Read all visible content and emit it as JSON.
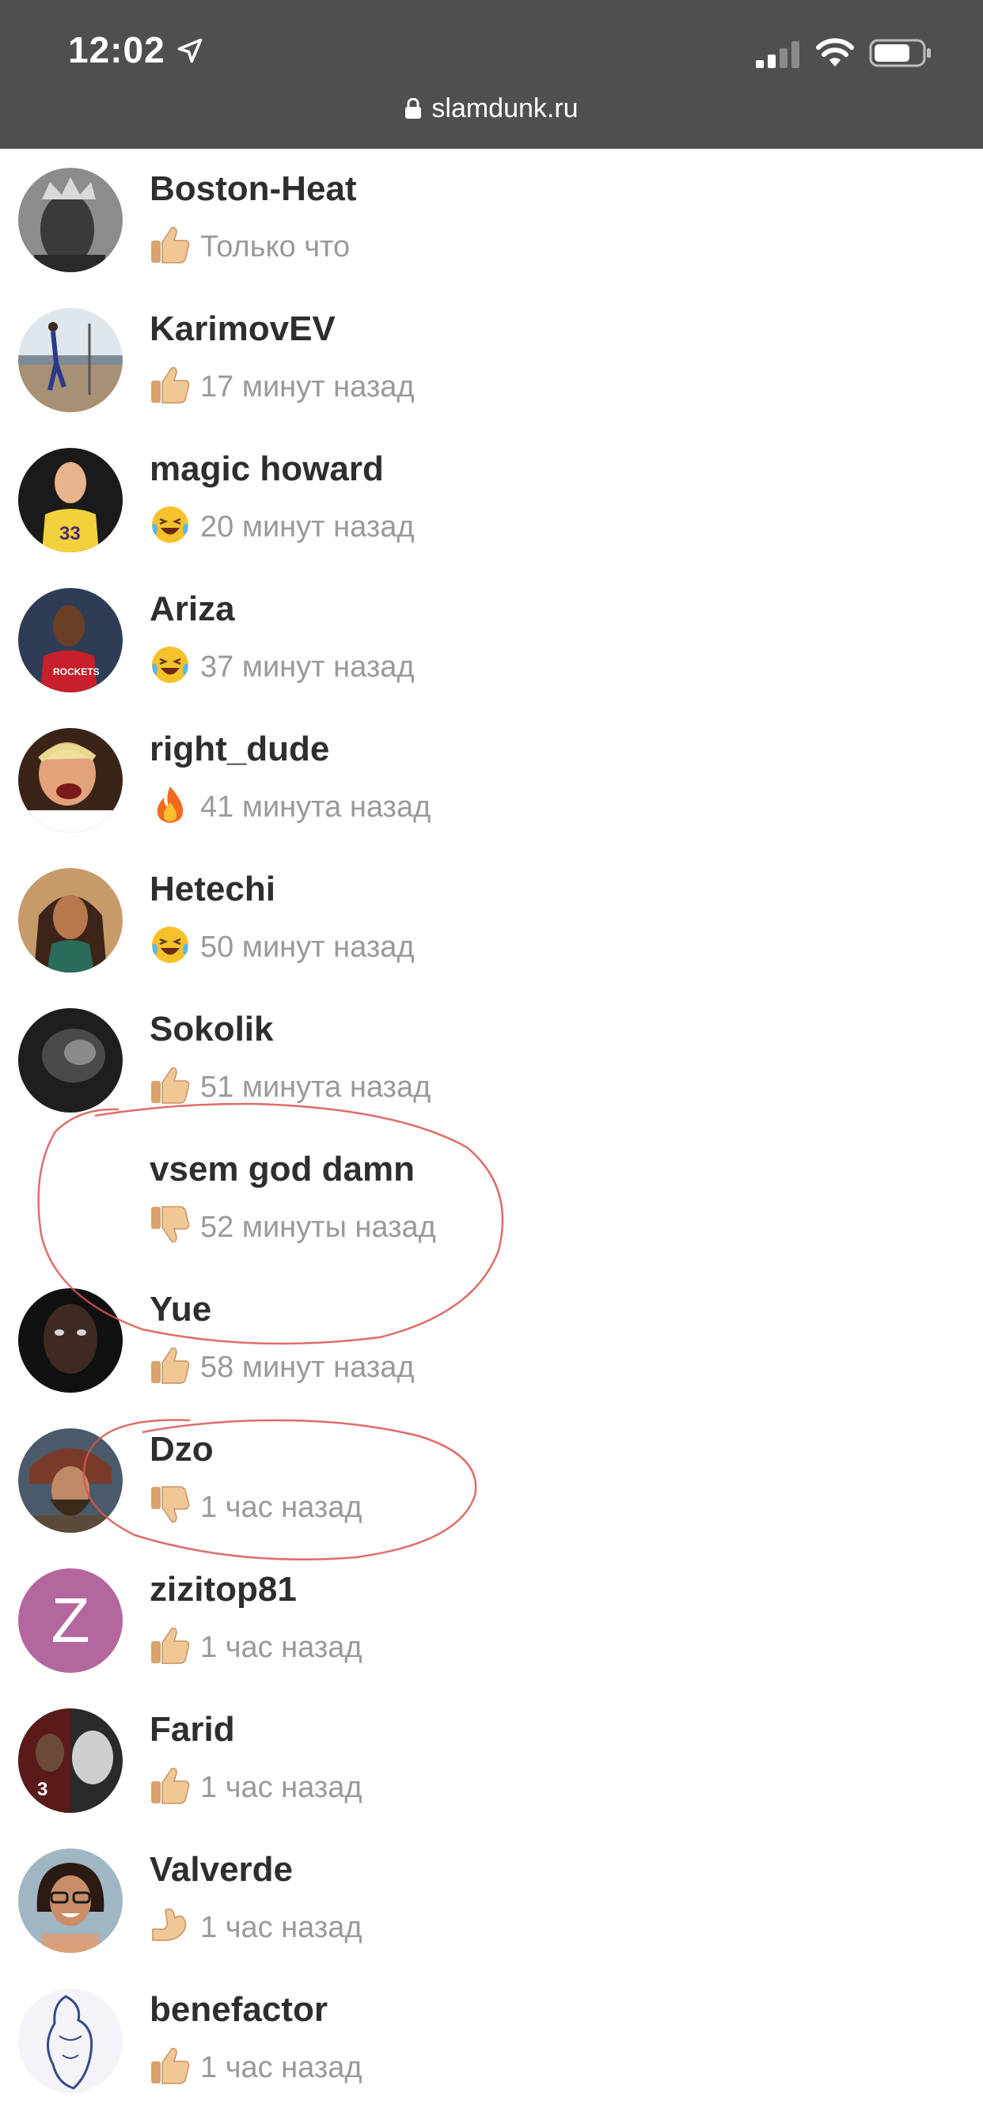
{
  "status_bar": {
    "time": "12:02",
    "url": "slamdunk.ru",
    "background_color": "#4f4f4f",
    "icons": [
      "location-arrow-icon",
      "signal-icon",
      "wifi-icon",
      "battery-icon",
      "lock-icon"
    ]
  },
  "reactions_list": [
    {
      "name": "Boston-Heat",
      "time": "Только что",
      "reaction": "thumbs-up"
    },
    {
      "name": "KarimovEV",
      "time": "17 минут назад",
      "reaction": "thumbs-up"
    },
    {
      "name": "magic howard",
      "time": "20 минут назад",
      "reaction": "laughing"
    },
    {
      "name": "Ariza",
      "time": "37 минут назад",
      "reaction": "laughing"
    },
    {
      "name": "right_dude",
      "time": "41 минута назад",
      "reaction": "fire"
    },
    {
      "name": "Hetechi",
      "time": "50 минут назад",
      "reaction": "laughing"
    },
    {
      "name": "Sokolik",
      "time": "51 минута назад",
      "reaction": "thumbs-up"
    },
    {
      "name": "vsem god damn",
      "time": "52 минуты назад",
      "reaction": "thumbs-down"
    },
    {
      "name": "Yue",
      "time": "58 минут назад",
      "reaction": "thumbs-up"
    },
    {
      "name": "Dzo",
      "time": "1 час назад",
      "reaction": "thumbs-down"
    },
    {
      "name": "zizitop81",
      "time": "1 час назад",
      "reaction": "thumbs-up",
      "avatar_letter": "Z"
    },
    {
      "name": "Farid",
      "time": "1 час назад",
      "reaction": "thumbs-up"
    },
    {
      "name": "Valverde",
      "time": "1 час назад",
      "reaction": "flexed-biceps"
    },
    {
      "name": "benefactor",
      "time": "1 час назад",
      "reaction": "thumbs-up"
    }
  ],
  "colors": {
    "name_text": "#2e2e2e",
    "time_text": "#9a9a9a",
    "annotation": "#d9534f",
    "letter_avatar": "#b4679f"
  }
}
